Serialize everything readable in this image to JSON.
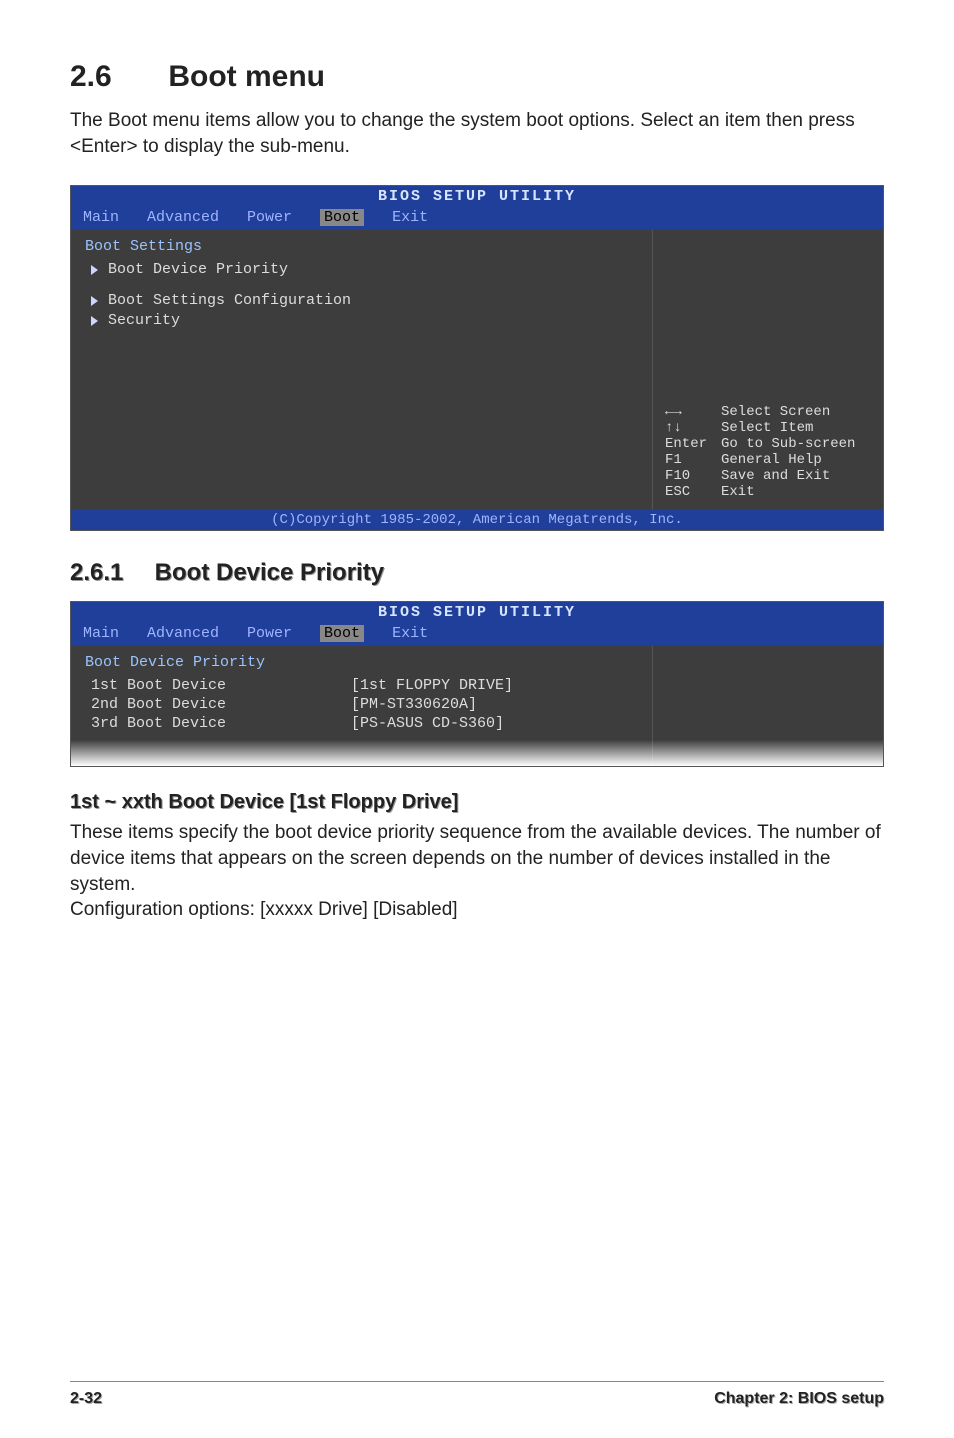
{
  "section": {
    "num": "2.6",
    "title": "Boot menu"
  },
  "intro": "The Boot menu items allow you to change the system boot options. Select an item then press <Enter> to display the sub-menu.",
  "bios1": {
    "top": "BIOS SETUP UTILITY",
    "tabs": [
      "Main",
      "Advanced",
      "Power",
      "Boot",
      "Exit"
    ],
    "activeTab": "Boot",
    "heading": "Boot Settings",
    "items": [
      "Boot Device Priority",
      "Boot Settings Configuration",
      "Security"
    ],
    "help": [
      {
        "k": "←→",
        "v": "Select Screen"
      },
      {
        "k": "↑↓",
        "v": "Select Item"
      },
      {
        "k": "Enter",
        "v": "Go to Sub-screen"
      },
      {
        "k": "F1",
        "v": "General Help"
      },
      {
        "k": "F10",
        "v": "Save and Exit"
      },
      {
        "k": "ESC",
        "v": "Exit"
      }
    ],
    "footer": "(C)Copyright 1985-2002, American Megatrends, Inc."
  },
  "subsection": {
    "num": "2.6.1",
    "title": "Boot Device Priority"
  },
  "bios2": {
    "top": "BIOS SETUP UTILITY",
    "tabs": [
      "Main",
      "Advanced",
      "Power",
      "Boot",
      "Exit"
    ],
    "activeTab": "Boot",
    "heading": "Boot Device Priority",
    "rows": [
      {
        "lbl": "1st Boot Device",
        "val": "[1st FLOPPY DRIVE]"
      },
      {
        "lbl": "2nd Boot Device",
        "val": "[PM-ST330620A]"
      },
      {
        "lbl": "3rd Boot Device",
        "val": "[PS-ASUS CD-S360]"
      }
    ]
  },
  "subhead": "1st ~ xxth Boot Device [1st Floppy Drive]",
  "body1": "These items specify the boot device priority sequence from the available devices. The number of device items that appears on the screen depends on the number of devices installed in the system.",
  "body2": "Configuration options: [xxxxx Drive] [Disabled]",
  "footer": {
    "left": "2-32",
    "right": "Chapter 2: BIOS setup"
  }
}
